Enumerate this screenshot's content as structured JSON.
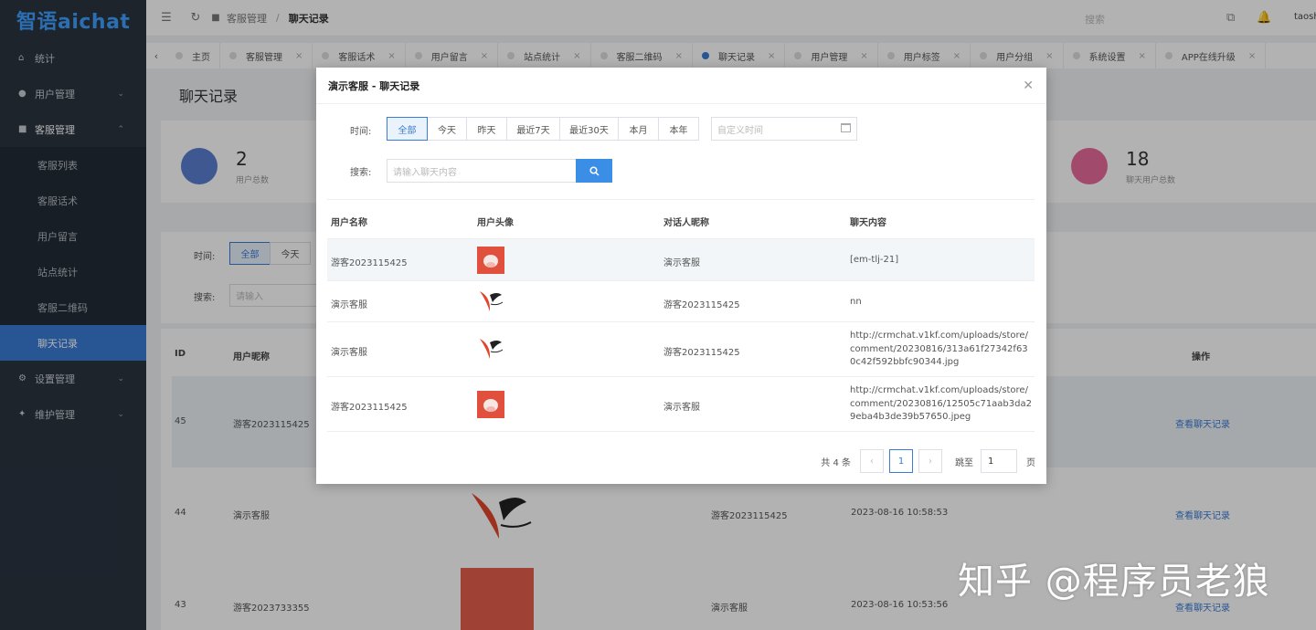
{
  "app": {
    "logo_text": "智语aichat"
  },
  "sidebar": {
    "items": [
      {
        "label": "统计",
        "icon": "home-icon"
      },
      {
        "label": "用户管理",
        "icon": "user-icon"
      },
      {
        "label": "客服管理",
        "icon": "chat-icon"
      },
      {
        "label": "设置管理",
        "icon": "gear-icon"
      },
      {
        "label": "维护管理",
        "icon": "wrench-icon"
      }
    ],
    "sub_items": [
      "客服列表",
      "客服话术",
      "用户留言",
      "站点统计",
      "客服二维码",
      "聊天记录"
    ],
    "active_sub": "聊天记录"
  },
  "topbar": {
    "crumb_parent": "客服管理",
    "crumb_current": "聊天记录",
    "search_placeholder": "搜索",
    "user_name": "taosh"
  },
  "tabs": [
    {
      "label": "主页"
    },
    {
      "label": "客服管理"
    },
    {
      "label": "客服话术"
    },
    {
      "label": "用户留言"
    },
    {
      "label": "站点统计"
    },
    {
      "label": "客服二维码"
    },
    {
      "label": "聊天记录",
      "active": true
    },
    {
      "label": "用户管理"
    },
    {
      "label": "用户标签"
    },
    {
      "label": "用户分组"
    },
    {
      "label": "系统设置"
    },
    {
      "label": "APP在线升级"
    }
  ],
  "page": {
    "title": "聊天记录",
    "stats": [
      {
        "value": "2",
        "label": "用户总数"
      },
      {
        "value": "18",
        "label": "聊天用户总数"
      }
    ],
    "filter": {
      "time_label": "时间:",
      "search_label": "搜索:",
      "btn_all": "全部",
      "btn_today": "今天",
      "search_placeholder": "请输入"
    },
    "table": {
      "headers": {
        "id": "ID",
        "nickname": "用户昵称",
        "action": "操作"
      },
      "rows": [
        {
          "id": "45",
          "nickname": "游客2023115425",
          "action": "查看聊天记录"
        },
        {
          "id": "44",
          "nickname": "演示客服",
          "peer": "游客2023115425",
          "time": "2023-08-16 10:58:53",
          "action": "查看聊天记录"
        },
        {
          "id": "43",
          "nickname": "游客2023733355",
          "peer": "演示客服",
          "time": "2023-08-16 10:53:56",
          "action": "查看聊天记录"
        }
      ]
    }
  },
  "modal": {
    "title": "演示客服 - 聊天记录",
    "time_label": "时间:",
    "search_label": "搜索:",
    "time_buttons": [
      "全部",
      "今天",
      "昨天",
      "最近7天",
      "最近30天",
      "本月",
      "本年"
    ],
    "date_placeholder": "自定义时间",
    "search_placeholder": "请输入聊天内容",
    "columns": [
      "用户名称",
      "用户头像",
      "对话人昵称",
      "聊天内容"
    ],
    "rows": [
      {
        "name": "游客2023115425",
        "avatar": "cow-avatar",
        "peer": "演示客服",
        "content": "[em-tlj-21]"
      },
      {
        "name": "演示客服",
        "avatar": "bird-avatar",
        "peer": "游客2023115425",
        "content": "nn"
      },
      {
        "name": "演示客服",
        "avatar": "bird-avatar",
        "peer": "游客2023115425",
        "content": "http://crmchat.v1kf.com/uploads/store/comment/20230816/313a61f27342f630c42f592bbfc90344.jpg"
      },
      {
        "name": "游客2023115425",
        "avatar": "cow-avatar",
        "peer": "演示客服",
        "content": "http://crmchat.v1kf.com/uploads/store/comment/20230816/12505c71aab3da29eba4b3de39b57650.jpeg"
      }
    ],
    "pager": {
      "total": "共 4 条",
      "current": "1",
      "goto_label": "跳至",
      "goto_value": "1",
      "page_unit": "页"
    }
  },
  "watermark": "知乎 @程序员老狼",
  "colors": {
    "accent": "#3a7bd5",
    "sidebar_bg": "#2b3440",
    "logo": "#3ea0ff"
  }
}
